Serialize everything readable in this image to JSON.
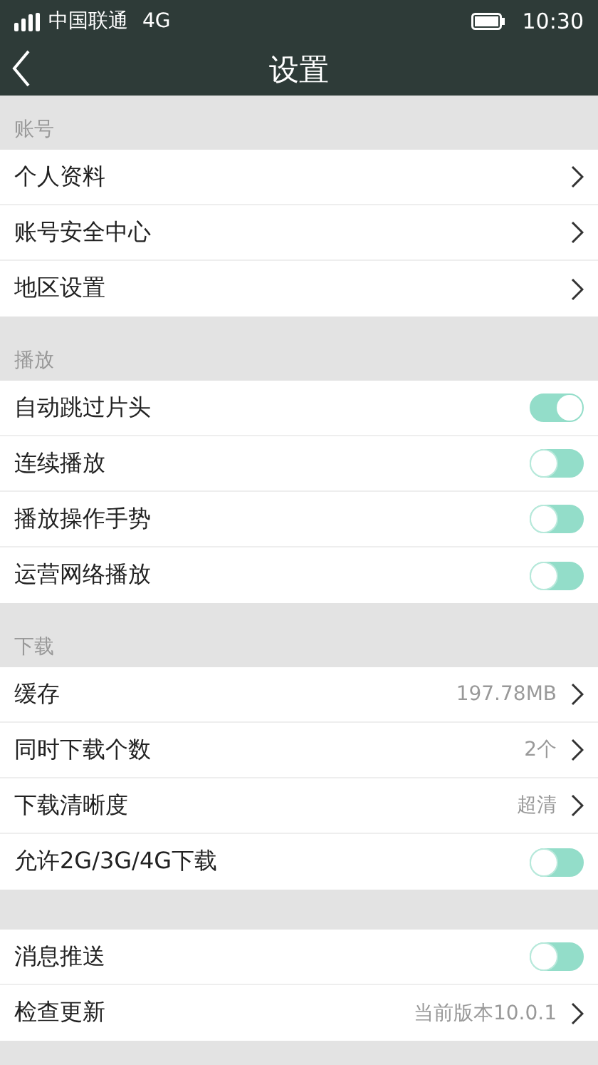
{
  "status_bar": {
    "carrier": "中国联通",
    "network": "4G",
    "time": "10:30"
  },
  "nav_bar": {
    "title": "设置"
  },
  "sections": [
    {
      "title": "账号",
      "rows": [
        {
          "kind": "link",
          "label": "个人资料"
        },
        {
          "kind": "link",
          "label": "账号安全中心"
        },
        {
          "kind": "link",
          "label": "地区设置"
        }
      ]
    },
    {
      "title": "播放",
      "rows": [
        {
          "kind": "toggle",
          "label": "自动跳过片头",
          "on": true
        },
        {
          "kind": "toggle",
          "label": "连续播放",
          "on": false
        },
        {
          "kind": "toggle",
          "label": "播放操作手势",
          "on": false
        },
        {
          "kind": "toggle",
          "label": "运营网络播放",
          "on": false
        }
      ]
    },
    {
      "title": "下载",
      "rows": [
        {
          "kind": "link",
          "label": "缓存",
          "value": "197.78MB"
        },
        {
          "kind": "link",
          "label": "同时下载个数",
          "value": "2个"
        },
        {
          "kind": "link",
          "label": "下载清晰度",
          "value": "超清"
        },
        {
          "kind": "toggle",
          "label": "允许2G/3G/4G下载",
          "on": false
        }
      ]
    },
    {
      "rows": [
        {
          "kind": "toggle",
          "label": "消息推送",
          "on": false
        },
        {
          "kind": "link",
          "label": "检查更新",
          "value": "当前版本10.0.1"
        }
      ]
    }
  ]
}
